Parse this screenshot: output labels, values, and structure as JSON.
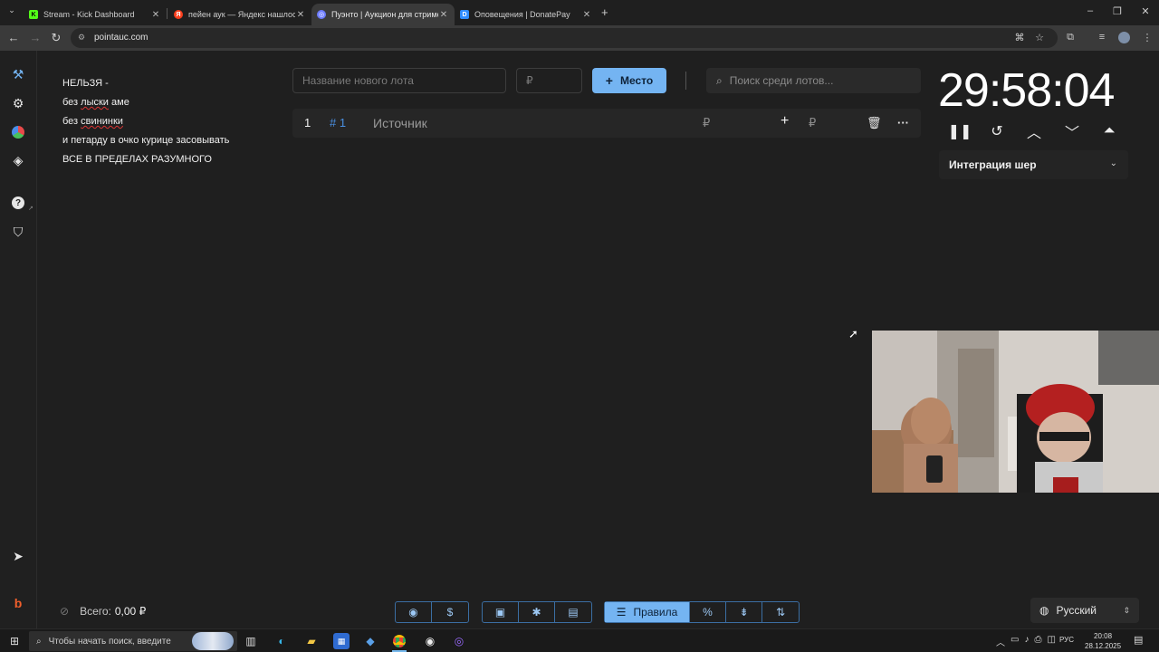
{
  "browser": {
    "tabs": [
      {
        "title": "Stream - Kick Dashboard",
        "favicon": "kick-icon",
        "color": "#53fc18",
        "active": false
      },
      {
        "title": "пейен аук — Яндекс нашлось",
        "favicon": "yandex-icon",
        "color": "#fc3f1d",
        "active": false
      },
      {
        "title": "Пуэнто | Аукцион для стримеров",
        "favicon": "pointauc-icon",
        "color": "#6c7bff",
        "active": true
      },
      {
        "title": "Оповещения | DonatePay",
        "favicon": "donatepay-icon",
        "color": "#2f8cff",
        "active": false
      }
    ],
    "url": "pointauc.com"
  },
  "rules_text": [
    "НЕЛЬЗЯ -",
    "без лыски аме",
    "без свининки",
    "и петарду в очко курице засовывать",
    "ВСЕ В ПРЕДЕЛАХ РАЗУМНОГО"
  ],
  "new_lot": {
    "name_placeholder": "Название нового лота",
    "amount_placeholder": "₽",
    "add_button_label": "Место",
    "search_placeholder": "Поиск среди лотов..."
  },
  "lots": [
    {
      "position": "1",
      "id": "# 1",
      "name": "Источник",
      "currency": "₽",
      "add_currency": "₽"
    }
  ],
  "timer": {
    "display": "29:58:04"
  },
  "integration": {
    "label": "Интеграция шер"
  },
  "footer": {
    "total_label": "Всего:",
    "total_value": "0,00 ₽",
    "rules_button": "Правила",
    "language": "Русский"
  },
  "taskbar": {
    "search_placeholder": "Чтобы начать поиск, введите",
    "time": "20:08",
    "date": "28.12.2025",
    "lang": "РУС"
  },
  "colors": {
    "accent": "#74b4f2",
    "background": "#1f1f1f"
  }
}
